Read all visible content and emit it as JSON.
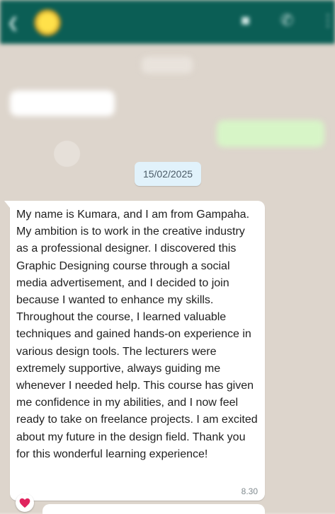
{
  "chat": {
    "date_separator": "15/02/2025",
    "message": {
      "text": "My name is Kumara, and I am from Gampaha. My ambition is to work in the creative industry as a professional designer. I discovered this Graphic Designing course through a social media advertisement, and I decided to join because I wanted to enhance my skills. Throughout the course, I learned valuable techniques and gained hands-on experience in various design tools. The lecturers were extremely supportive, always guiding me whenever I needed help. This course has given me confidence in my abilities, and I now feel ready to take on freelance projects. I am excited about my future in the design field. Thank you for this wonderful learning experience!",
      "time": "8.30",
      "reaction_icon": "red-heart-icon"
    }
  },
  "colors": {
    "header": "#0b5e55",
    "incoming_bubble": "#ffffff",
    "outgoing_bubble": "#d7f5c7",
    "date_chip": "#e1f2fb",
    "reaction_heart": "#e0245e"
  }
}
